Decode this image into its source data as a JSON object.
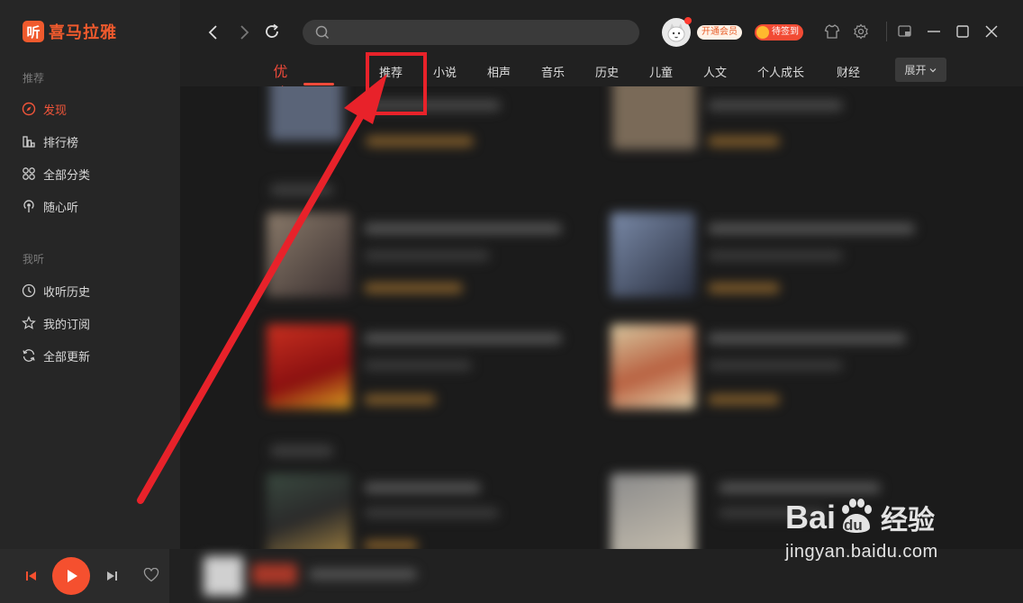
{
  "app": {
    "logo_glyph": "听",
    "logo_text": "喜马拉雅"
  },
  "sidebar": {
    "section1_title": "推荐",
    "items1": [
      {
        "label": "发现",
        "icon": "compass-icon",
        "active": true
      },
      {
        "label": "排行榜",
        "icon": "chart-icon"
      },
      {
        "label": "全部分类",
        "icon": "grid-icon"
      },
      {
        "label": "随心听",
        "icon": "radio-icon"
      }
    ],
    "section2_title": "我听",
    "items2": [
      {
        "label": "收听历史",
        "icon": "clock-icon"
      },
      {
        "label": "我的订阅",
        "icon": "star-icon"
      },
      {
        "label": "全部更新",
        "icon": "refresh-icon"
      }
    ]
  },
  "topbar": {
    "search_placeholder": "",
    "vip_label": "开通会员",
    "sign_label": "待签到"
  },
  "tabs": {
    "featured": "优选专区",
    "items": [
      "推荐",
      "小说",
      "相声",
      "音乐",
      "历史",
      "儿童",
      "人文",
      "个人成长",
      "财经"
    ],
    "expand": "展开"
  },
  "watermark": {
    "brand_left": "Bai",
    "brand_mid": "du",
    "brand_right": "经验",
    "url": "jingyan.baidu.com"
  },
  "colors": {
    "accent": "#f05a2d",
    "annotation": "#e8222a"
  }
}
